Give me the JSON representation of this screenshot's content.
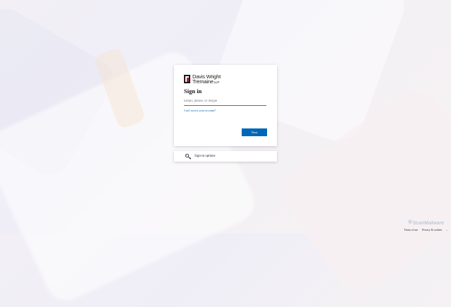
{
  "logo": {
    "line1": "Davis Wright",
    "line2": "Tremaine",
    "suffix": "LLP"
  },
  "signin": {
    "title": "Sign in",
    "email_placeholder": "Email, phone, or Skype",
    "email_value": "",
    "cant_access": "Can't access your account?",
    "next_label": "Next"
  },
  "options": {
    "label": "Sign-in options"
  },
  "footer": {
    "terms": "Terms of use",
    "privacy": "Privacy & cookies",
    "more": "..."
  },
  "watermark": "ScanMalware",
  "colors": {
    "accent": "#0067b8",
    "brand_red": "#b5202e"
  }
}
